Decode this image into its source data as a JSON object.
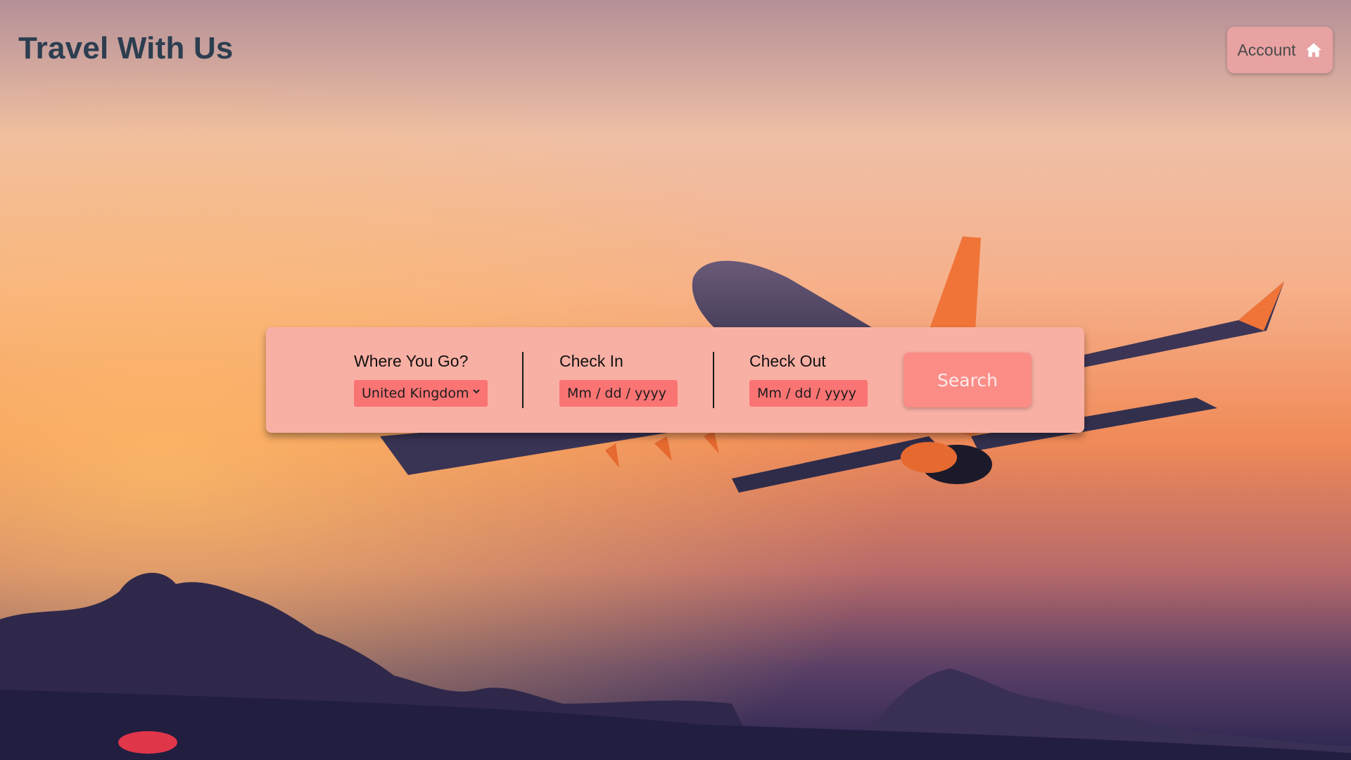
{
  "header": {
    "title": "Travel With Us",
    "account_label": "Account",
    "account_icon": "home-icon"
  },
  "search_panel": {
    "destination": {
      "label": "Where You Go?",
      "selected": "United Kingdom"
    },
    "check_in": {
      "label": "Check In",
      "placeholder": "Mm / dd / yyyy"
    },
    "check_out": {
      "label": "Check Out",
      "placeholder": "Mm / dd / yyyy"
    },
    "search_label": "Search"
  },
  "colors": {
    "panel_bg": "#f8b0a4",
    "input_bg": "#fb7474",
    "search_button": "#fb8c86",
    "account_button": "#e8a2a2",
    "title_text": "#2c3e50"
  }
}
